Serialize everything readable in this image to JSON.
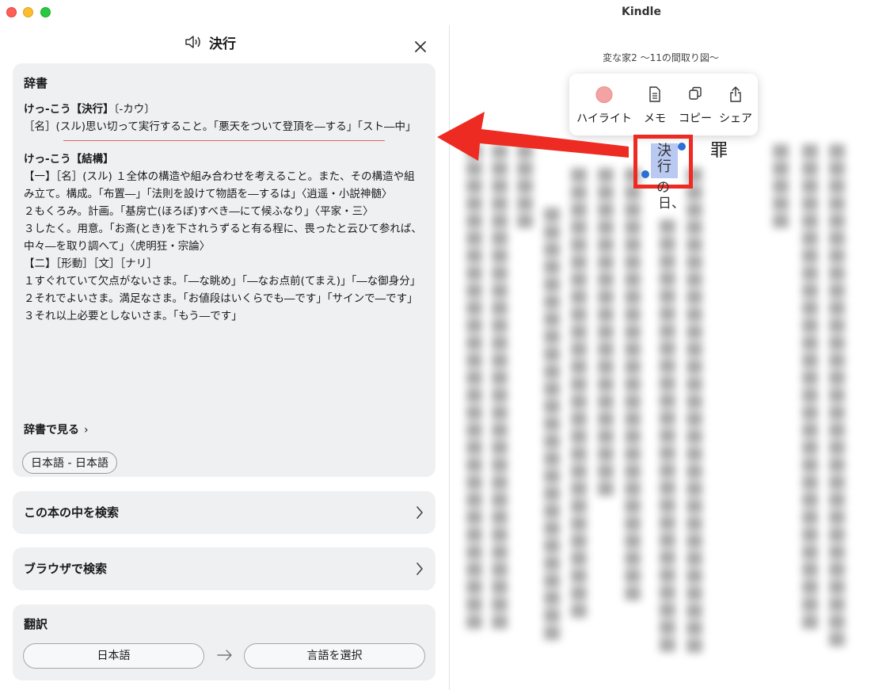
{
  "window": {
    "app_title": "Kindle"
  },
  "panel": {
    "title": "決行",
    "dictionary": {
      "heading": "辞書",
      "entry1": {
        "headword": "けっ-こう【決行】",
        "reading": "〔-カウ〕",
        "definition": "［名］(スル)思い切って実行すること。「悪天をついて登頂を―する」「スト―中」"
      },
      "entry2": {
        "headword": "けっ-こう【結構】",
        "lines": [
          "【一】［名］(スル) １全体の構造や組み合わせを考えること。また、その構造や組み立て。構成。「布置―」「法則を設けて物語を―するは」〈逍遥・小説神髄〉",
          "２もくろみ。計画。「基房亡(ほろぼ)すべき―にて候ふなり」〈平家・三〉",
          "３したく。用意。「お斎(とき)を下されうずると有る程に、畏ったと云ひて参れば、中々―を取り調へて」〈虎明狂・宗論〉",
          "【二】［形動］［文］［ナリ］",
          "１すぐれていて欠点がないさま。「―な眺め」「―なお点前(てまえ)」「―な御身分」",
          "２それでよいさま。満足なさま。「お値段はいくらでも―です」「サインで―です」",
          "３それ以上必要としないさま。「もう―です」"
        ]
      },
      "see_in_dictionary": "辞書で見る",
      "dictionary_name": "日本語 - 日本語"
    },
    "search_in_book": "この本の中を検索",
    "search_in_browser": "ブラウザで検索",
    "translate": {
      "heading": "翻訳",
      "from_lang": "日本語",
      "to_lang": "言語を選択"
    }
  },
  "reader": {
    "book_title": "変な家2 〜11の間取り図〜",
    "selected_text": "決行",
    "nearby_chars": {
      "right": "罪",
      "below1": "の",
      "below2": "日、"
    },
    "popover": {
      "highlight": "ハイライト",
      "memo": "メモ",
      "copy": "コピー",
      "share": "シェア"
    }
  },
  "colors": {
    "accent_red": "#ee2b22",
    "selection_blue": "#b9c9f2",
    "highlight_pink": "#f2a3a3"
  }
}
